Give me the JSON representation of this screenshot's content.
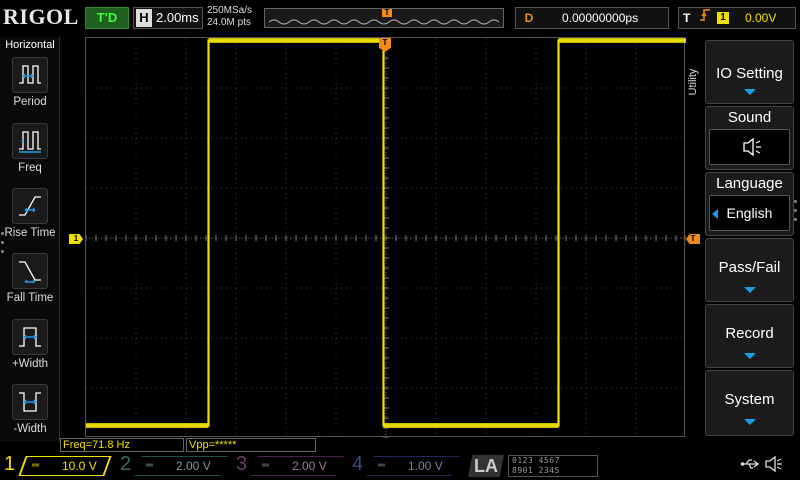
{
  "header": {
    "logo": "RIGOL",
    "trigger_status": "T'D",
    "horizontal_key": "H",
    "timebase": "2.00ms",
    "sample_rate": "250MSa/s",
    "memory_depth": "24.0M pts",
    "trigger_position_label": "T",
    "delay_key": "D",
    "delay_value": "0.00000000ps",
    "trigger_key": "T",
    "trigger_edge": "⬏",
    "trigger_source": "1",
    "trigger_level": "0.00V"
  },
  "left_panel": {
    "title": "Horizontal",
    "items": [
      {
        "label": "Period",
        "icon": "period-icon"
      },
      {
        "label": "Freq",
        "icon": "freq-icon"
      },
      {
        "label": "Rise Time",
        "icon": "rise-time-icon"
      },
      {
        "label": "Fall Time",
        "icon": "fall-time-icon"
      },
      {
        "label": "+Width",
        "icon": "positive-width-icon"
      },
      {
        "label": "-Width",
        "icon": "negative-width-icon"
      }
    ]
  },
  "markers": {
    "channel1": "1",
    "trigger_level": "T",
    "trigger_position": "T"
  },
  "measurements": {
    "freq": "Freq=71.8 Hz",
    "vpp": "Vpp=*****"
  },
  "right_menu": {
    "tab_label": "Utility",
    "items": [
      {
        "label": "IO Setting"
      },
      {
        "label": "Sound",
        "value_icon": "speaker-icon",
        "value": "◁⃦"
      },
      {
        "label": "Language",
        "value": "English"
      },
      {
        "label": "Pass/Fail"
      },
      {
        "label": "Record"
      },
      {
        "label": "System"
      }
    ]
  },
  "channels": [
    {
      "number": "1",
      "coupling": "═",
      "scale": "10.0 V",
      "color": "#f0e000",
      "active": true
    },
    {
      "number": "2",
      "coupling": "═",
      "scale": "2.00 V",
      "color": "#00c0c0",
      "active": false
    },
    {
      "number": "3",
      "coupling": "═",
      "scale": "2.00 V",
      "color": "#d040d0",
      "active": false
    },
    {
      "number": "4",
      "coupling": "═",
      "scale": "1.00 V",
      "color": "#3070e0",
      "active": false
    }
  ],
  "logic_analyzer": {
    "label": "LA",
    "bits_row1": "0123 4567",
    "bits_row2": "8901 2345"
  },
  "status_icons": {
    "usb": "⭍",
    "sound": "🔈"
  },
  "colors": {
    "ch1": "#f0e000",
    "trigger": "#f28a1a",
    "accent": "#1e9be8"
  },
  "waveform": {
    "channel": "1",
    "shape": "square",
    "high_level_div": 3.95,
    "low_level_div": -3.75,
    "transitions_div": [
      -3.55,
      -0.05,
      3.45
    ],
    "initial_state": "low"
  }
}
